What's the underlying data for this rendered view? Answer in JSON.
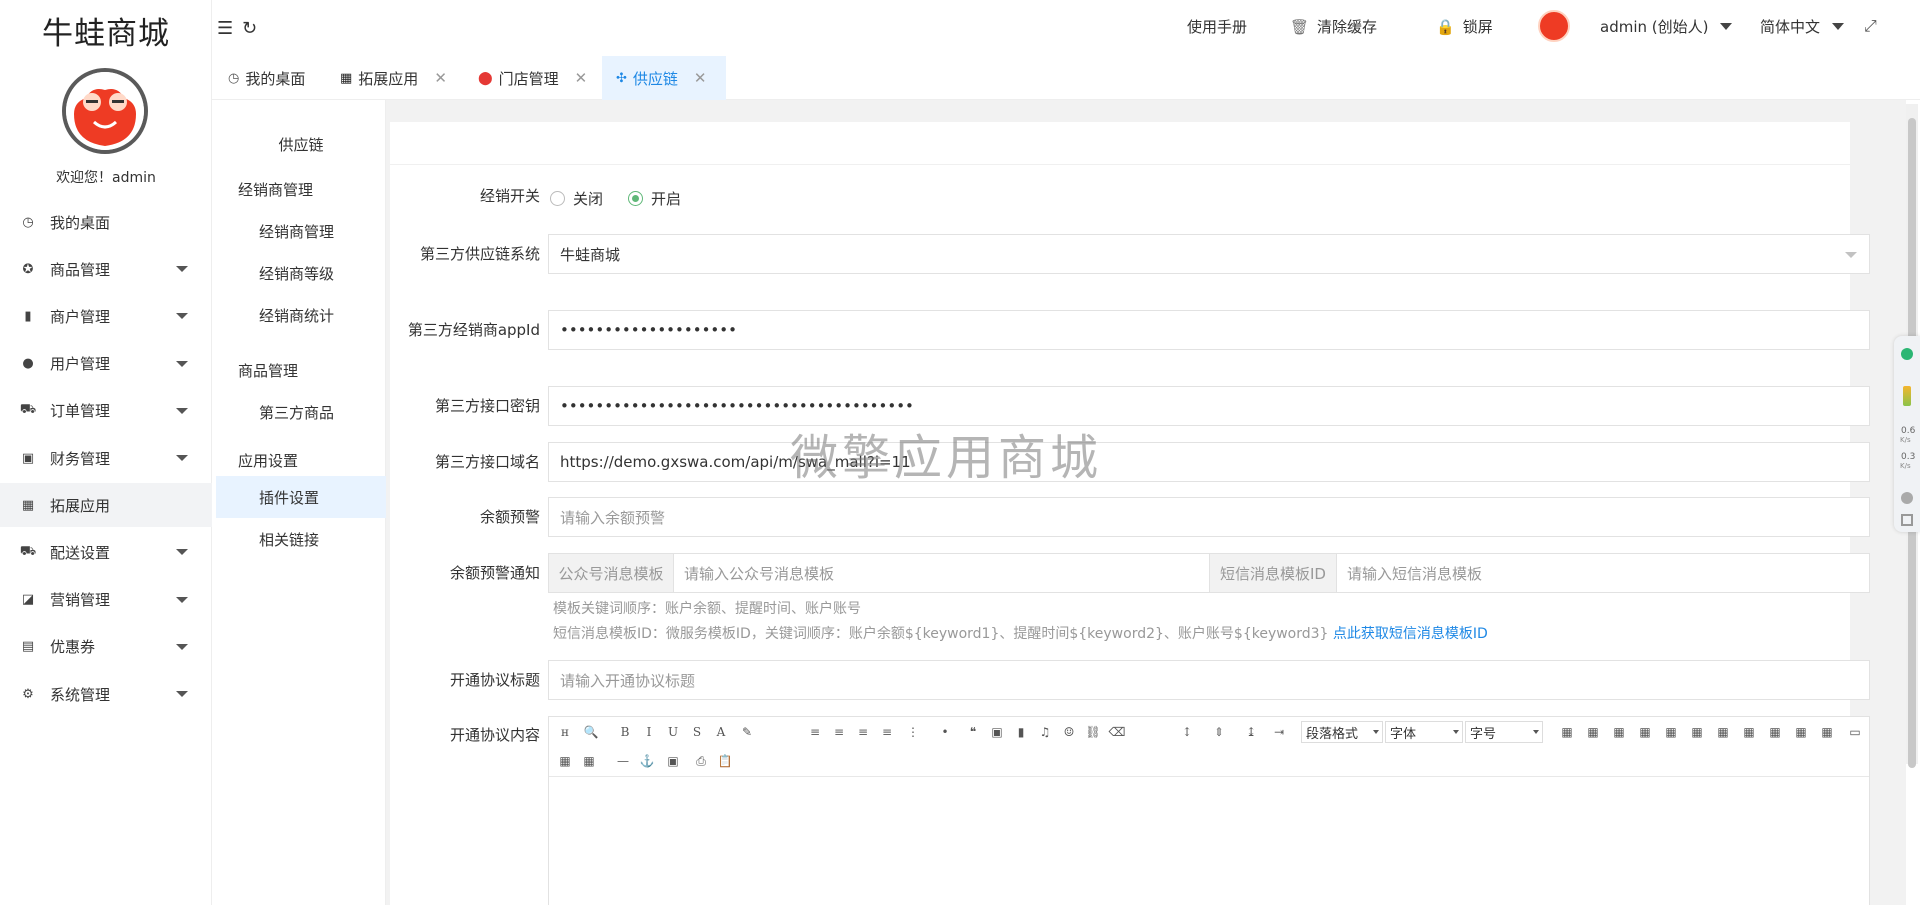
{
  "app": {
    "logo": "牛蛙商城",
    "welcome": "欢迎您！admin"
  },
  "sidebar": {
    "items": [
      {
        "label": "我的桌面",
        "icon": "dashboard-icon",
        "glyph": "◷",
        "caret": false,
        "active": false
      },
      {
        "label": "商品管理",
        "icon": "goods-icon",
        "glyph": "✪",
        "caret": true,
        "active": false
      },
      {
        "label": "商户管理",
        "icon": "merchant-icon",
        "glyph": "▮",
        "caret": true,
        "active": false
      },
      {
        "label": "用户管理",
        "icon": "user-icon",
        "glyph": "●",
        "caret": true,
        "active": false
      },
      {
        "label": "订单管理",
        "icon": "cart-icon",
        "glyph": "⛟",
        "caret": true,
        "active": false
      },
      {
        "label": "财务管理",
        "icon": "finance-icon",
        "glyph": "▣",
        "caret": true,
        "active": false
      },
      {
        "label": "拓展应用",
        "icon": "grid-icon",
        "glyph": "▦",
        "caret": false,
        "active": true
      },
      {
        "label": "配送设置",
        "icon": "truck-icon",
        "glyph": "⛟",
        "caret": true,
        "active": false
      },
      {
        "label": "营销管理",
        "icon": "marketing-icon",
        "glyph": "◪",
        "caret": true,
        "active": false
      },
      {
        "label": "优惠券",
        "icon": "coupon-icon",
        "glyph": "▤",
        "caret": true,
        "active": false
      },
      {
        "label": "系统管理",
        "icon": "gear-icon",
        "glyph": "⚙",
        "caret": true,
        "active": false
      }
    ]
  },
  "header": {
    "manual": "使用手册",
    "clear_cache": "清除缓存",
    "lock": "锁屏",
    "user": "admin (创始人)",
    "language": "简体中文"
  },
  "tabs": [
    {
      "label": "我的桌面",
      "icon": "dashboard-icon",
      "closable": false,
      "active": false
    },
    {
      "label": "拓展应用",
      "icon": "grid-icon",
      "closable": true,
      "active": false
    },
    {
      "label": "门店管理",
      "icon": "store-icon",
      "closable": true,
      "active": false
    },
    {
      "label": "供应链",
      "icon": "supply-chain-icon",
      "closable": true,
      "active": true
    }
  ],
  "subnav": {
    "title": "供应链",
    "groups": [
      {
        "label": "经销商管理",
        "items": [
          "经销商管理",
          "经销商等级",
          "经销商统计"
        ]
      },
      {
        "label": "商品管理",
        "items": [
          "第三方商品"
        ]
      },
      {
        "label": "应用设置",
        "items": [
          "插件设置",
          "相关链接"
        ]
      }
    ],
    "active_item": "插件设置"
  },
  "form": {
    "switch": {
      "label": "经销开关",
      "off": "关闭",
      "on": "开启",
      "value": "开启"
    },
    "system": {
      "label": "第三方供应链系统",
      "value": "牛蛙商城"
    },
    "appid": {
      "label": "第三方经销商appId",
      "value": "••••••••••••••••••••"
    },
    "secret": {
      "label": "第三方接口密钥",
      "value": "••••••••••••••••••••••••••••••••••••••••"
    },
    "domain": {
      "label": "第三方接口域名",
      "value": "https://demo.gxswa.com/api/m/swa_mall?i=11"
    },
    "balance_warn": {
      "label": "余额预警",
      "placeholder": "请输入余额预警"
    },
    "balance_notice": {
      "label": "余额预警通知",
      "mp_addon": "公众号消息模板",
      "mp_placeholder": "请输入公众号消息模板",
      "sms_addon": "短信消息模板ID",
      "sms_placeholder": "请输入短信消息模板",
      "help1": "模板关键词顺序：账户余额、提醒时间、账户账号",
      "help2": "短信消息模板ID：微服务模板ID，关键词顺序：账户余额${keyword1}、提醒时间${keyword2}、账户账号${keyword3}",
      "help_link": "点此获取短信消息模板ID"
    },
    "protocol_title": {
      "label": "开通协议标题",
      "placeholder": "请输入开通协议标题"
    },
    "protocol_content": {
      "label": "开通协议内容",
      "paragraph_select": "段落格式",
      "font_select": "字体",
      "size_select": "字号"
    }
  },
  "watermark": "微擎应用商城",
  "float_widget": {
    "speed_up": "0.6",
    "speed_down": "0.3",
    "unit": "K/s"
  }
}
